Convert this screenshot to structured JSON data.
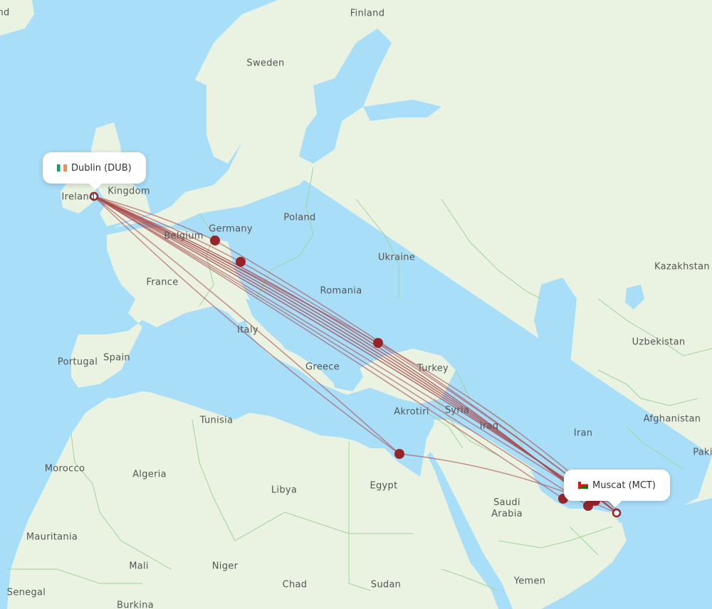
{
  "map": {
    "colors": {
      "water": "#a9def9",
      "land": "#eaf3e2",
      "land_alt": "#e1eed7",
      "border": "#9fd39b",
      "route": "#9b2226",
      "route_line": "#a8474a",
      "airport_dot": "#96252a"
    },
    "origin": {
      "city": "Dublin",
      "code": "DUB",
      "label": "Dublin (DUB)",
      "flag": "ireland-flag-icon"
    },
    "destination": {
      "city": "Muscat",
      "code": "MCT",
      "label": "Muscat (MCT)",
      "flag": "oman-flag-icon"
    },
    "country_labels": [
      "nd",
      "Finland",
      "Sweden",
      "Kingdom",
      "Ireland",
      "Poland",
      "Germany",
      "Belgium",
      "Ukraine",
      "France",
      "Romania",
      "Kazakhstan",
      "Italy",
      "Portugal",
      "Spain",
      "Greece",
      "Turkey",
      "Uzbekistan",
      "Akrotiri",
      "Syria",
      "Tunisia",
      "Iraq",
      "Iran",
      "Afghanistan",
      "Paki",
      "Morocco",
      "Algeria",
      "Libya",
      "Egypt",
      "Saudi Arabia",
      "Mauritania",
      "Mali",
      "Niger",
      "Chad",
      "Sudan",
      "Yemen",
      "Senegal",
      "Burkina"
    ],
    "stopovers": [
      "Frankfurt area",
      "Munich area",
      "Istanbul area",
      "Cairo area",
      "Doha area",
      "Abu Dhabi area",
      "Dubai area"
    ]
  }
}
